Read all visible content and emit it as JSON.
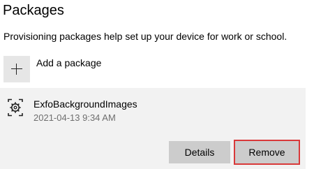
{
  "page": {
    "title": "Packages",
    "description": "Provisioning packages help set up your device for work or school."
  },
  "add_package": {
    "label": "Add a package",
    "icon": "plus-icon"
  },
  "package": {
    "name": "ExfoBackgroundImages",
    "date": "2021-04-13 9:34 AM",
    "icon": "package-gear-icon"
  },
  "actions": {
    "details_label": "Details",
    "remove_label": "Remove"
  },
  "colors": {
    "highlight_border": "#d9393a",
    "button_bg": "#cccccc",
    "card_bg": "#f2f2f2"
  }
}
